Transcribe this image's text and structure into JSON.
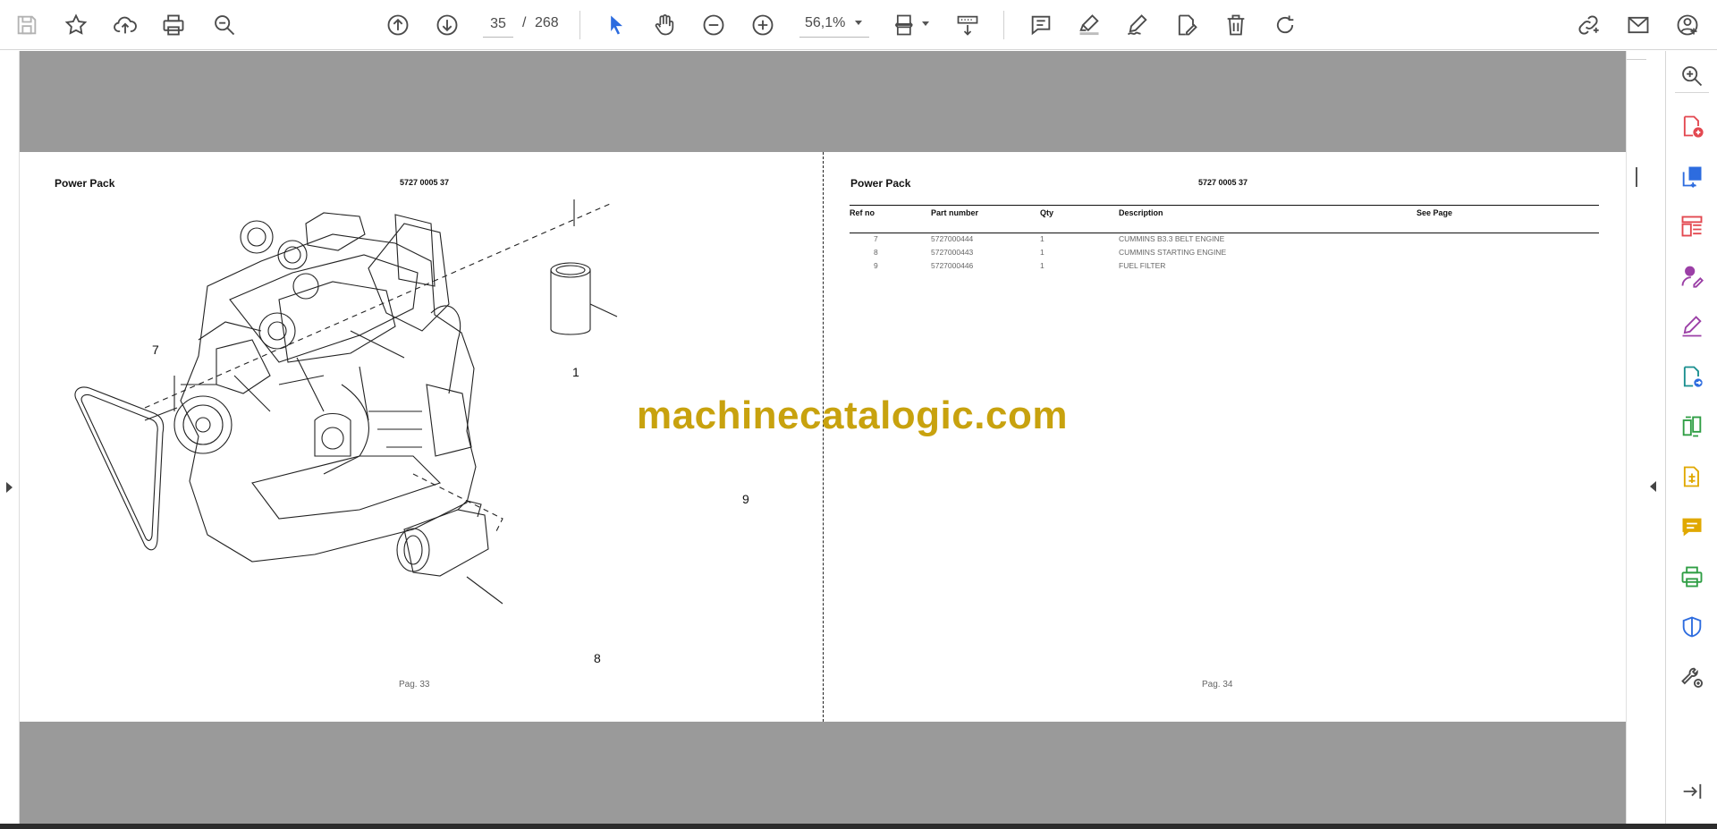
{
  "toolbar": {
    "page_current": "35",
    "page_separator": "/",
    "page_total": "268",
    "zoom": "56,1%",
    "icons": [
      "save-icon",
      "bookmark-star-icon",
      "cloud-upload-icon",
      "print-icon",
      "search-zoom-icon",
      "previous-page-icon",
      "next-page-icon",
      "select-cursor-icon",
      "hand-tool-icon",
      "zoom-out-icon",
      "zoom-in-icon",
      "fit-page-icon",
      "scroll-mode-icon",
      "comment-icon",
      "highlight-icon",
      "sign-icon",
      "edit-pdf-icon",
      "delete-icon",
      "rotate-icon",
      "share-link-icon",
      "email-icon",
      "account-icon"
    ]
  },
  "left_page": {
    "title": "Power Pack",
    "code": "5727 0005 37",
    "page_label": "Pag. 33",
    "callouts": [
      "7",
      "1",
      "9",
      "8"
    ]
  },
  "right_page": {
    "title": "Power Pack",
    "code": "5727 0005 37",
    "page_label": "Pag. 34",
    "table": {
      "headers": [
        "Ref no",
        "Part number",
        "Qty",
        "Description",
        "See Page"
      ],
      "rows": [
        [
          "7",
          "5727000444",
          "1",
          "CUMMINS B3.3 BELT ENGINE",
          ""
        ],
        [
          "8",
          "5727000443",
          "1",
          "CUMMINS STARTING ENGINE",
          ""
        ],
        [
          "9",
          "5727000446",
          "1",
          "FUEL FILTER",
          ""
        ]
      ]
    }
  },
  "watermark": "machinecatalogic.com",
  "right_panel": {
    "icons": [
      "search-zoom-panel-icon",
      "create-pdf-icon",
      "export-pdf-icon",
      "organize-pages-icon",
      "fill-sign-icon",
      "request-signature-icon",
      "send-for-review-icon",
      "compare-files-icon",
      "scan-ocr-icon",
      "comment-panel-icon",
      "print-production-icon",
      "protect-icon",
      "more-tools-icon",
      "collapse-panel-icon"
    ],
    "colors": {
      "red": "#e34850",
      "blue": "#2d6cdf",
      "purple": "#9b3fa6",
      "teal": "#1a8f8f",
      "green": "#2f9e44",
      "yellow": "#e0a800"
    }
  }
}
